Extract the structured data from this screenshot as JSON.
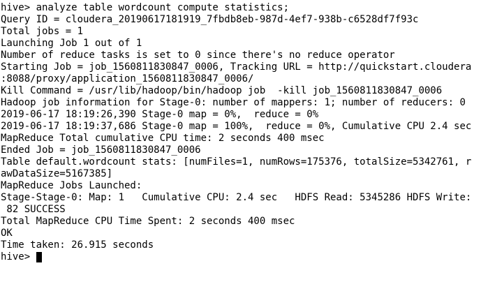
{
  "terminal": {
    "lines": [
      "hive> analyze table wordcount compute statistics;",
      "Query ID = cloudera_20190617181919_7fbdb8eb-987d-4ef7-938b-c6528df7f93c",
      "Total jobs = 1",
      "Launching Job 1 out of 1",
      "Number of reduce tasks is set to 0 since there's no reduce operator",
      "Starting Job = job_1560811830847_0006, Tracking URL = http://quickstart.cloudera",
      ":8088/proxy/application_1560811830847_0006/",
      "Kill Command = /usr/lib/hadoop/bin/hadoop job  -kill job_1560811830847_0006",
      "Hadoop job information for Stage-0: number of mappers: 1; number of reducers: 0",
      "2019-06-17 18:19:26,390 Stage-0 map = 0%,  reduce = 0%",
      "2019-06-17 18:19:37,686 Stage-0 map = 100%,  reduce = 0%, Cumulative CPU 2.4 sec",
      "MapReduce Total cumulative CPU time: 2 seconds 400 msec",
      "Ended Job = job_1560811830847_0006",
      "Table default.wordcount stats: [numFiles=1, numRows=175376, totalSize=5342761, r",
      "awDataSize=5167385]",
      "MapReduce Jobs Launched:",
      "Stage-Stage-0: Map: 1   Cumulative CPU: 2.4 sec   HDFS Read: 5345286 HDFS Write:",
      " 82 SUCCESS",
      "Total MapReduce CPU Time Spent: 2 seconds 400 msec",
      "OK",
      "Time taken: 26.915 seconds"
    ],
    "prompt": "hive> "
  }
}
